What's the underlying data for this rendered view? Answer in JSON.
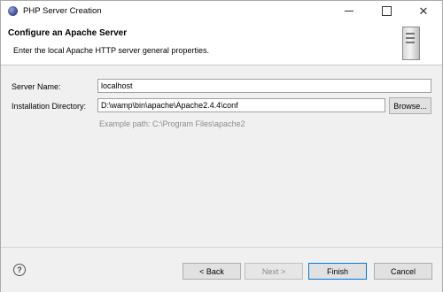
{
  "window": {
    "title": "PHP Server Creation",
    "icon": "eclipse-php-icon",
    "controls": [
      "minimize-icon",
      "maximize-icon",
      "close-icon"
    ]
  },
  "header": {
    "title": "Configure an Apache Server",
    "description": "Enter the local Apache HTTP server general properties.",
    "icon": "server-icon"
  },
  "form": {
    "server_name": {
      "label": "Server Name:",
      "value": "localhost"
    },
    "install_dir": {
      "label": "Installation Directory:",
      "value": "D:\\wamp\\bin\\apache\\Apache2.4.4\\conf",
      "browse_label": "Browse...",
      "hint": "Example path: C:\\Program Files\\apache2"
    }
  },
  "footer": {
    "help_icon": "help-icon",
    "back_label": "< Back",
    "next_label": "Next >",
    "finish_label": "Finish",
    "cancel_label": "Cancel"
  },
  "colors": {
    "accent": "#0078d7",
    "content_bg": "#f0f0f0",
    "hint_text": "#8c8c8c"
  }
}
